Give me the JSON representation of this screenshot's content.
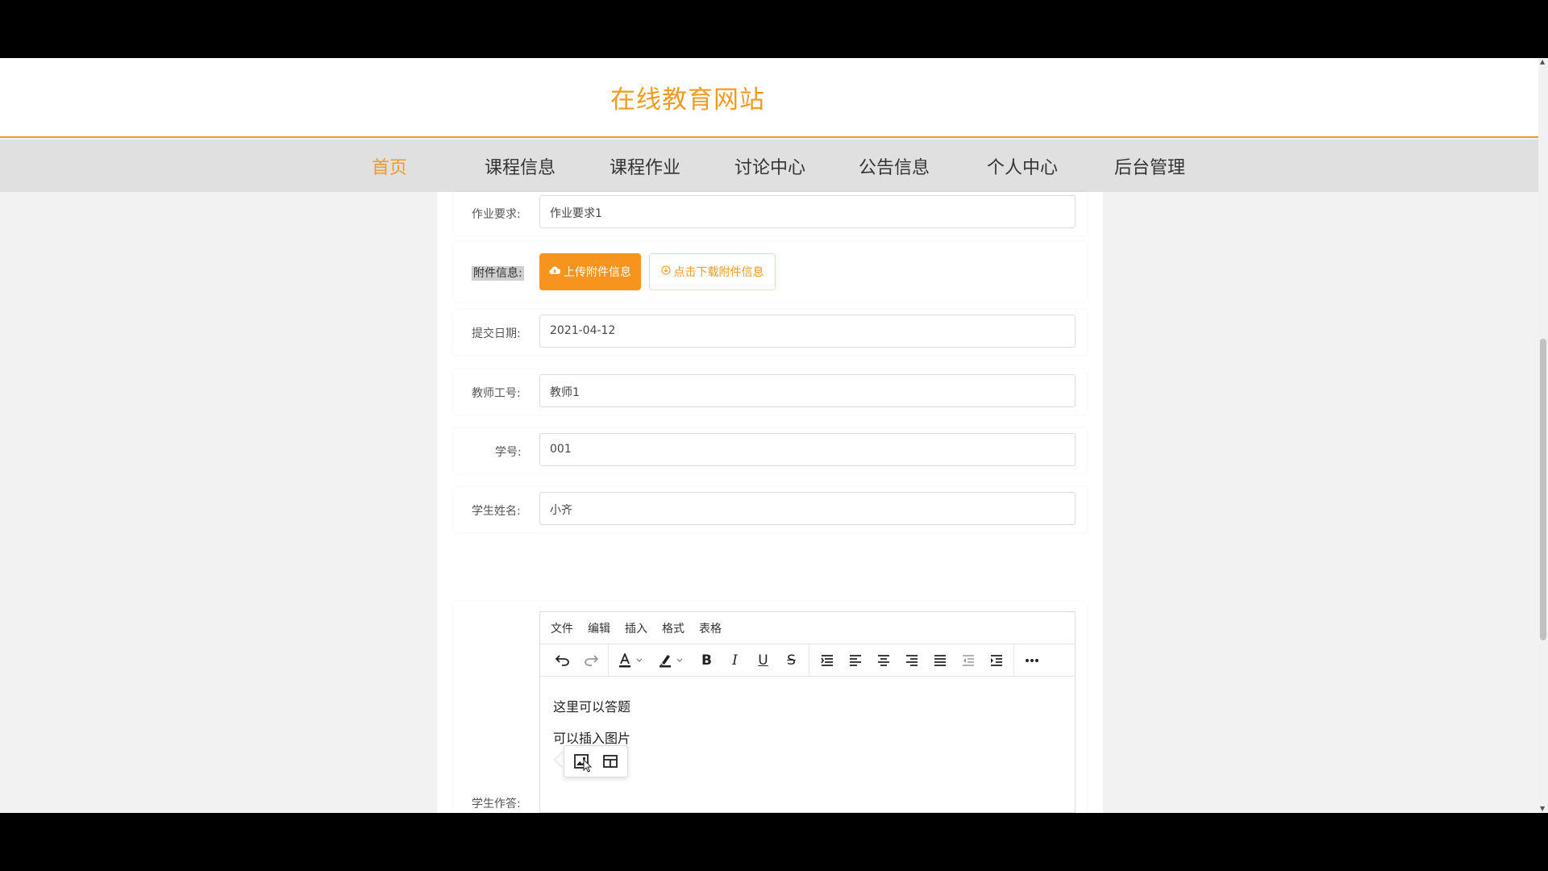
{
  "header": {
    "site_title": "在线教育网站"
  },
  "nav": {
    "items": [
      {
        "label": "首页",
        "active": true
      },
      {
        "label": "课程信息"
      },
      {
        "label": "课程作业"
      },
      {
        "label": "讨论中心"
      },
      {
        "label": "公告信息"
      },
      {
        "label": "个人中心"
      },
      {
        "label": "后台管理"
      }
    ]
  },
  "form": {
    "requirement": {
      "label": "作业要求:",
      "value": "作业要求1"
    },
    "attachment": {
      "label": "附件信息:",
      "upload_label": "上传附件信息",
      "download_label": "点击下载附件信息"
    },
    "submit_date": {
      "label": "提交日期:",
      "value": "2021-04-12"
    },
    "teacher_id": {
      "label": "教师工号:",
      "value": "教师1"
    },
    "student_no": {
      "label": "学号:",
      "value": "001"
    },
    "student_name": {
      "label": "学生姓名:",
      "value": "小齐"
    },
    "student_answer": {
      "label": "学生作答:"
    }
  },
  "editor": {
    "menu": [
      "文件",
      "编辑",
      "插入",
      "格式",
      "表格"
    ],
    "content": [
      "这里可以答题",
      "可以插入图片"
    ],
    "toolbar_icons": [
      "undo-icon",
      "redo-icon",
      "text-color-icon",
      "highlight-icon",
      "bold-icon",
      "italic-icon",
      "underline-icon",
      "strikethrough-icon",
      "line-height-icon",
      "align-left-icon",
      "align-center-icon",
      "align-right-icon",
      "align-justify-icon",
      "outdent-icon",
      "indent-icon",
      "more-icon"
    ],
    "quickbar_icons": [
      "image-icon",
      "table-icon"
    ]
  },
  "colors": {
    "accent": "#f29b21",
    "nav_bg": "#e0e0e0"
  }
}
